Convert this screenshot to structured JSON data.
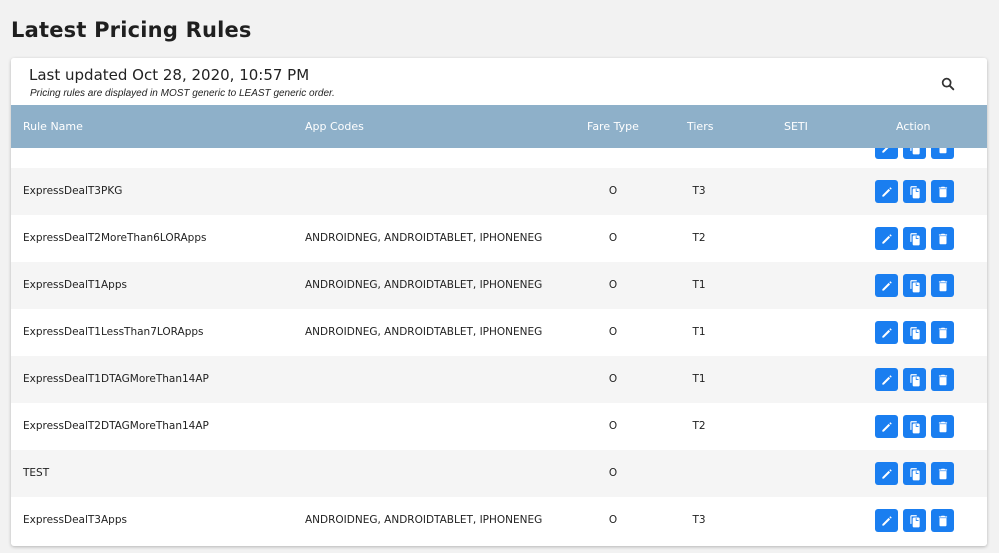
{
  "page_title": "Latest Pricing Rules",
  "header": {
    "last_updated": "Last updated Oct 28, 2020, 10:57 PM",
    "note": "Pricing rules are displayed in MOST generic to LEAST generic order.",
    "search_icon": "search-icon"
  },
  "columns": {
    "rule_name": "Rule Name",
    "app_codes": "App Codes",
    "fare_type": "Fare Type",
    "tiers": "Tiers",
    "seti": "SETI",
    "action": "Action"
  },
  "action_icons": [
    "edit-icon",
    "copy-icon",
    "delete-icon"
  ],
  "colors": {
    "header_bar": "#8eb0c9",
    "action_button": "#1a7ef0"
  },
  "rows": [
    {
      "rule_name": "ExpressDealT3PKG",
      "app_codes": "",
      "fare_type": "O",
      "tier": "T3",
      "seti": ""
    },
    {
      "rule_name": "ExpressDealT2MoreThan6LORApps",
      "app_codes": "ANDROIDNEG, ANDROIDTABLET, IPHONENEG",
      "fare_type": "O",
      "tier": "T2",
      "seti": ""
    },
    {
      "rule_name": "ExpressDealT1Apps",
      "app_codes": "ANDROIDNEG, ANDROIDTABLET, IPHONENEG",
      "fare_type": "O",
      "tier": "T1",
      "seti": ""
    },
    {
      "rule_name": "ExpressDealT1LessThan7LORApps",
      "app_codes": "ANDROIDNEG, ANDROIDTABLET, IPHONENEG",
      "fare_type": "O",
      "tier": "T1",
      "seti": ""
    },
    {
      "rule_name": "ExpressDealT1DTAGMoreThan14AP",
      "app_codes": "",
      "fare_type": "O",
      "tier": "T1",
      "seti": ""
    },
    {
      "rule_name": "ExpressDealT2DTAGMoreThan14AP",
      "app_codes": "",
      "fare_type": "O",
      "tier": "T2",
      "seti": ""
    },
    {
      "rule_name": "TEST",
      "app_codes": "",
      "fare_type": "O",
      "tier": "",
      "seti": ""
    },
    {
      "rule_name": "ExpressDealT3Apps",
      "app_codes": "ANDROIDNEG, ANDROIDTABLET, IPHONENEG",
      "fare_type": "O",
      "tier": "T3",
      "seti": ""
    }
  ]
}
